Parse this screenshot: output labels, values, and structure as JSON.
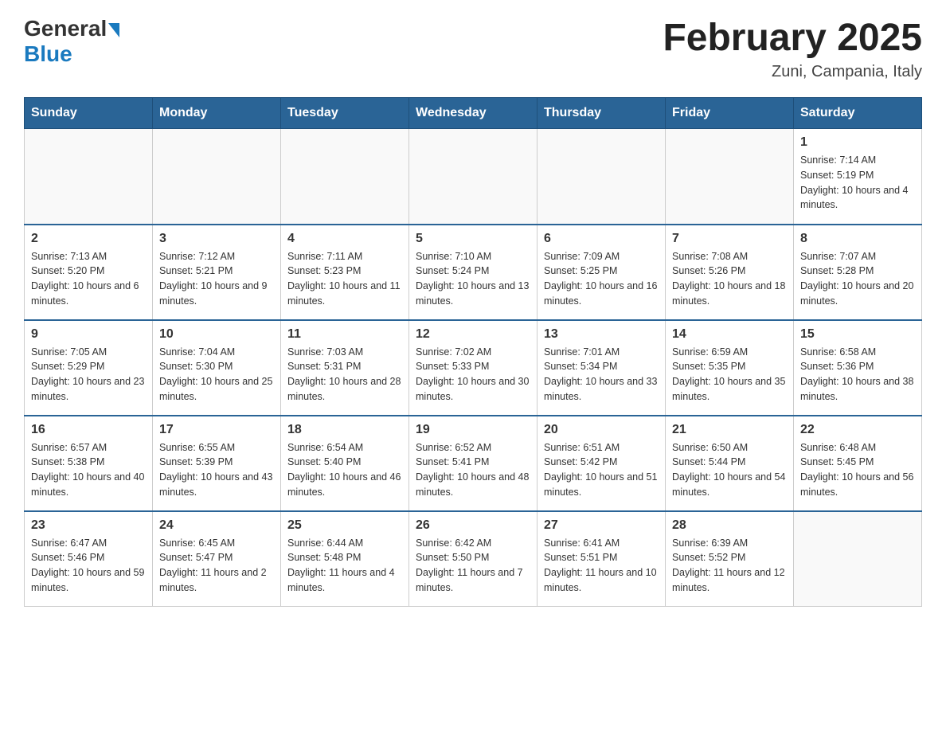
{
  "header": {
    "logo_general": "General",
    "logo_blue": "Blue",
    "month_title": "February 2025",
    "location": "Zuni, Campania, Italy"
  },
  "weekdays": [
    "Sunday",
    "Monday",
    "Tuesday",
    "Wednesday",
    "Thursday",
    "Friday",
    "Saturday"
  ],
  "weeks": [
    [
      {
        "day": "",
        "info": ""
      },
      {
        "day": "",
        "info": ""
      },
      {
        "day": "",
        "info": ""
      },
      {
        "day": "",
        "info": ""
      },
      {
        "day": "",
        "info": ""
      },
      {
        "day": "",
        "info": ""
      },
      {
        "day": "1",
        "info": "Sunrise: 7:14 AM\nSunset: 5:19 PM\nDaylight: 10 hours and 4 minutes."
      }
    ],
    [
      {
        "day": "2",
        "info": "Sunrise: 7:13 AM\nSunset: 5:20 PM\nDaylight: 10 hours and 6 minutes."
      },
      {
        "day": "3",
        "info": "Sunrise: 7:12 AM\nSunset: 5:21 PM\nDaylight: 10 hours and 9 minutes."
      },
      {
        "day": "4",
        "info": "Sunrise: 7:11 AM\nSunset: 5:23 PM\nDaylight: 10 hours and 11 minutes."
      },
      {
        "day": "5",
        "info": "Sunrise: 7:10 AM\nSunset: 5:24 PM\nDaylight: 10 hours and 13 minutes."
      },
      {
        "day": "6",
        "info": "Sunrise: 7:09 AM\nSunset: 5:25 PM\nDaylight: 10 hours and 16 minutes."
      },
      {
        "day": "7",
        "info": "Sunrise: 7:08 AM\nSunset: 5:26 PM\nDaylight: 10 hours and 18 minutes."
      },
      {
        "day": "8",
        "info": "Sunrise: 7:07 AM\nSunset: 5:28 PM\nDaylight: 10 hours and 20 minutes."
      }
    ],
    [
      {
        "day": "9",
        "info": "Sunrise: 7:05 AM\nSunset: 5:29 PM\nDaylight: 10 hours and 23 minutes."
      },
      {
        "day": "10",
        "info": "Sunrise: 7:04 AM\nSunset: 5:30 PM\nDaylight: 10 hours and 25 minutes."
      },
      {
        "day": "11",
        "info": "Sunrise: 7:03 AM\nSunset: 5:31 PM\nDaylight: 10 hours and 28 minutes."
      },
      {
        "day": "12",
        "info": "Sunrise: 7:02 AM\nSunset: 5:33 PM\nDaylight: 10 hours and 30 minutes."
      },
      {
        "day": "13",
        "info": "Sunrise: 7:01 AM\nSunset: 5:34 PM\nDaylight: 10 hours and 33 minutes."
      },
      {
        "day": "14",
        "info": "Sunrise: 6:59 AM\nSunset: 5:35 PM\nDaylight: 10 hours and 35 minutes."
      },
      {
        "day": "15",
        "info": "Sunrise: 6:58 AM\nSunset: 5:36 PM\nDaylight: 10 hours and 38 minutes."
      }
    ],
    [
      {
        "day": "16",
        "info": "Sunrise: 6:57 AM\nSunset: 5:38 PM\nDaylight: 10 hours and 40 minutes."
      },
      {
        "day": "17",
        "info": "Sunrise: 6:55 AM\nSunset: 5:39 PM\nDaylight: 10 hours and 43 minutes."
      },
      {
        "day": "18",
        "info": "Sunrise: 6:54 AM\nSunset: 5:40 PM\nDaylight: 10 hours and 46 minutes."
      },
      {
        "day": "19",
        "info": "Sunrise: 6:52 AM\nSunset: 5:41 PM\nDaylight: 10 hours and 48 minutes."
      },
      {
        "day": "20",
        "info": "Sunrise: 6:51 AM\nSunset: 5:42 PM\nDaylight: 10 hours and 51 minutes."
      },
      {
        "day": "21",
        "info": "Sunrise: 6:50 AM\nSunset: 5:44 PM\nDaylight: 10 hours and 54 minutes."
      },
      {
        "day": "22",
        "info": "Sunrise: 6:48 AM\nSunset: 5:45 PM\nDaylight: 10 hours and 56 minutes."
      }
    ],
    [
      {
        "day": "23",
        "info": "Sunrise: 6:47 AM\nSunset: 5:46 PM\nDaylight: 10 hours and 59 minutes."
      },
      {
        "day": "24",
        "info": "Sunrise: 6:45 AM\nSunset: 5:47 PM\nDaylight: 11 hours and 2 minutes."
      },
      {
        "day": "25",
        "info": "Sunrise: 6:44 AM\nSunset: 5:48 PM\nDaylight: 11 hours and 4 minutes."
      },
      {
        "day": "26",
        "info": "Sunrise: 6:42 AM\nSunset: 5:50 PM\nDaylight: 11 hours and 7 minutes."
      },
      {
        "day": "27",
        "info": "Sunrise: 6:41 AM\nSunset: 5:51 PM\nDaylight: 11 hours and 10 minutes."
      },
      {
        "day": "28",
        "info": "Sunrise: 6:39 AM\nSunset: 5:52 PM\nDaylight: 11 hours and 12 minutes."
      },
      {
        "day": "",
        "info": ""
      }
    ]
  ]
}
